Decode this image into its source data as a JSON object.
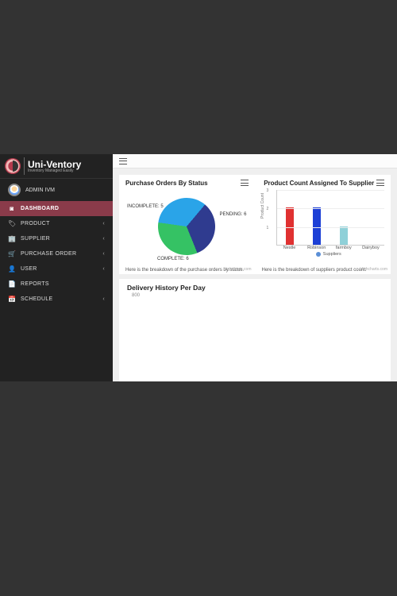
{
  "brand": {
    "title": "Uni-Ventory",
    "subtitle": "Inventory Managed Easily"
  },
  "user": {
    "name": "ADMIN IVM"
  },
  "sidebar": {
    "items": [
      {
        "label": "DASHBOARD",
        "icon": "◙",
        "active": true,
        "expandable": false
      },
      {
        "label": "PRODUCT",
        "icon": "🏷",
        "active": false,
        "expandable": true
      },
      {
        "label": "SUPPLIER",
        "icon": "🏢",
        "active": false,
        "expandable": true
      },
      {
        "label": "PURCHASE ORDER",
        "icon": "🛒",
        "active": false,
        "expandable": true
      },
      {
        "label": "USER",
        "icon": "👤",
        "active": false,
        "expandable": true
      },
      {
        "label": "REPORTS",
        "icon": "📄",
        "active": false,
        "expandable": false
      },
      {
        "label": "SCHEDULE",
        "icon": "📅",
        "active": false,
        "expandable": true
      }
    ]
  },
  "cards": {
    "pie": {
      "title": "Purchase Orders By Status",
      "labels": {
        "pending": "PENDING: 6",
        "incomplete": "INCOMPLETE: 5",
        "complete": "COMPLETE: 6"
      },
      "footer": "Here is the breakdown of the purchase orders by status.",
      "credit": "Highcharts.com"
    },
    "bar": {
      "title": "Product Count Assigned To Supplier",
      "yaxis_title": "Product Count",
      "legend": "Suppliers",
      "footer": "Here is the breakdown of suppliers product count.",
      "credit": "Highcharts.com"
    },
    "delivery": {
      "title": "Delivery History Per Day",
      "tick": "800"
    }
  },
  "chart_data": [
    {
      "type": "pie",
      "title": "Purchase Orders By Status",
      "series": [
        {
          "name": "PENDING",
          "value": 6,
          "color": "#2aa4e8"
        },
        {
          "name": "INCOMPLETE",
          "value": 5,
          "color": "#35c264"
        },
        {
          "name": "COMPLETE",
          "value": 6,
          "color": "#2f3b8f"
        }
      ]
    },
    {
      "type": "bar",
      "title": "Product Count Assigned To Supplier",
      "ylabel": "Product Count",
      "ylim": [
        0,
        3
      ],
      "yticks": [
        1,
        2,
        3
      ],
      "categories": [
        "Nestle",
        "Robinson",
        "farmboy",
        "Dairyboy"
      ],
      "values": [
        2,
        2,
        1,
        0
      ],
      "colors": [
        "#e03131",
        "#1c3fd6",
        "#8fd0d8",
        "#ffffff"
      ],
      "legend": [
        "Suppliers"
      ]
    },
    {
      "type": "line",
      "title": "Delivery History Per Day",
      "ylim": [
        0,
        800
      ],
      "yticks": [
        800
      ],
      "note": "chart body cut off in viewport"
    }
  ]
}
